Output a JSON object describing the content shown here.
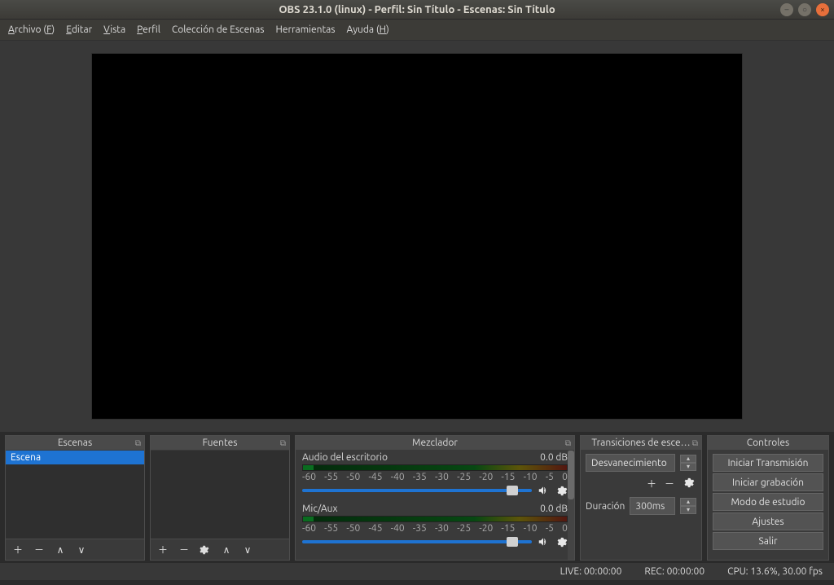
{
  "title": "OBS 23.1.0 (linux) - Perfil: Sin Título - Escenas: Sin Título",
  "menu": {
    "archivo": "Archivo (F)",
    "editar": "Editar",
    "vista": "Vista",
    "perfil": "Perfil",
    "coleccion": "Colección de Escenas",
    "herramientas": "Herramientas",
    "ayuda": "Ayuda (H)"
  },
  "panels": {
    "scenes": {
      "title": "Escenas",
      "items": [
        "Escena"
      ]
    },
    "sources": {
      "title": "Fuentes"
    },
    "mixer": {
      "title": "Mezclador",
      "tracks": [
        {
          "name": "Audio del escritorio",
          "db": "0.0 dB"
        },
        {
          "name": "Mic/Aux",
          "db": "0.0 dB"
        }
      ],
      "ticks": [
        "-60",
        "-55",
        "-50",
        "-45",
        "-40",
        "-35",
        "-30",
        "-25",
        "-20",
        "-15",
        "-10",
        "-5",
        "0"
      ]
    },
    "transitions": {
      "title": "Transiciones de esce…",
      "selected": "Desvanecimiento",
      "duration_label": "Duración",
      "duration_value": "300ms"
    },
    "controls": {
      "title": "Controles",
      "buttons": {
        "stream": "Iniciar Transmisión",
        "record": "Iniciar grabación",
        "studio": "Modo de estudio",
        "settings": "Ajustes",
        "exit": "Salir"
      }
    }
  },
  "status": {
    "live": "LIVE: 00:00:00",
    "rec": "REC: 00:00:00",
    "cpu": "CPU: 13.6%, 30.00 fps"
  }
}
